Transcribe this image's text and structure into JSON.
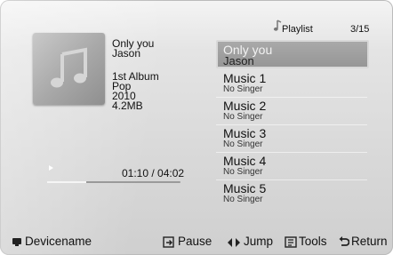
{
  "now_playing": {
    "title": "Only you",
    "artist": "Jason",
    "album": "1st Album",
    "genre": "Pop",
    "year": "2010",
    "size": "4.2MB",
    "time": "01:10 / 04:02",
    "progress": 0.29
  },
  "playlist": {
    "label": "Playlist",
    "count": "3/15",
    "items": [
      {
        "title": "Only you",
        "sub": "Jason",
        "selected": true
      },
      {
        "title": "Music 1",
        "sub": "No Singer"
      },
      {
        "title": "Music 2",
        "sub": "No Singer"
      },
      {
        "title": "Music 3",
        "sub": "No Singer"
      },
      {
        "title": "Music 4",
        "sub": "No Singer"
      },
      {
        "title": "Music 5",
        "sub": "No Singer"
      }
    ]
  },
  "bottom_bar": {
    "device": "Devicename",
    "pause": "Pause",
    "jump": "Jump",
    "tools": "Tools",
    "return": "Return"
  },
  "icons": {
    "album_art": "music-note-icon",
    "playlist": "music-note-icon",
    "device": "device-icon",
    "pause": "enter-icon",
    "jump": "left-right-arrows-icon",
    "tools": "tools-icon",
    "return": "return-icon"
  }
}
